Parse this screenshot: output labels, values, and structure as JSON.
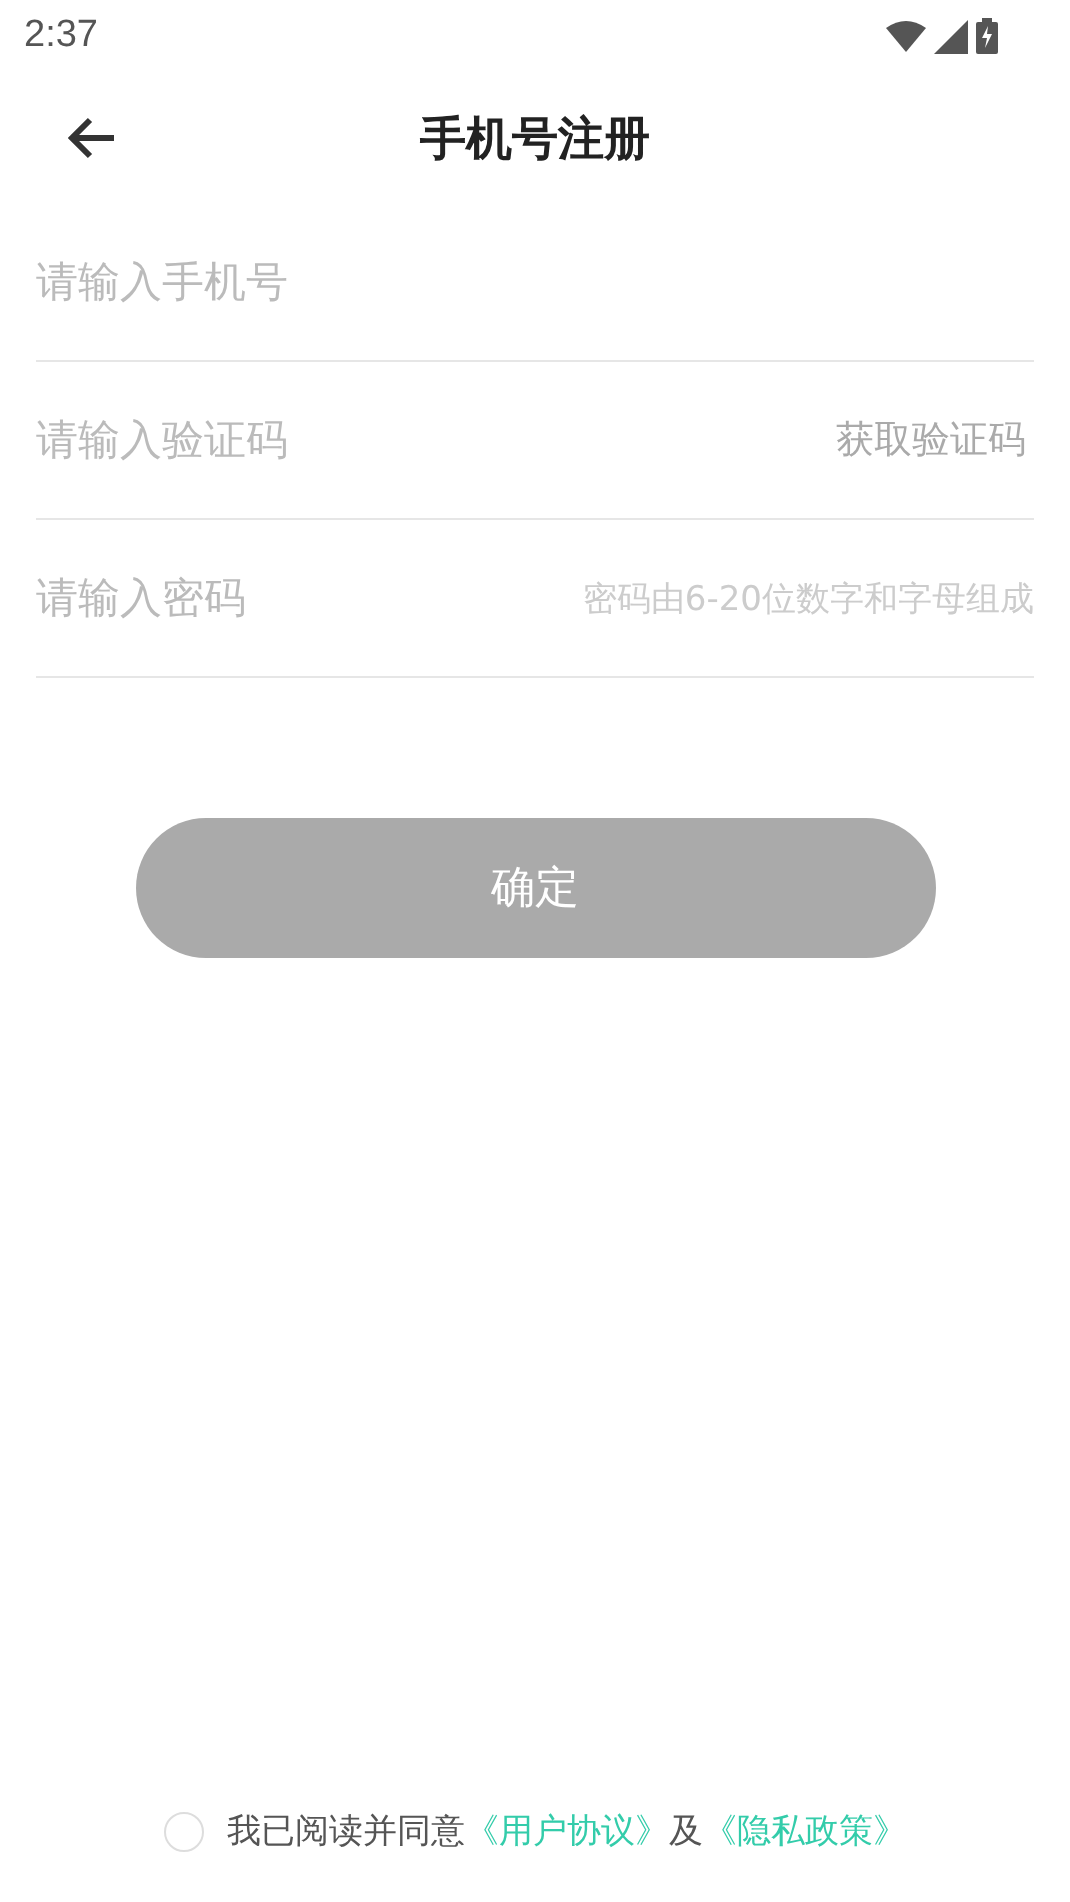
{
  "status_bar": {
    "time": "2:37"
  },
  "header": {
    "title": "手机号注册"
  },
  "fields": [
    {
      "kind": "plain",
      "placeholder": "请输入手机号"
    },
    {
      "kind": "code",
      "placeholder": "请输入验证码",
      "action": "获取验证码"
    },
    {
      "kind": "hint",
      "placeholder": "请输入密码",
      "hint": "密码由6-20位数字和字母组成"
    }
  ],
  "submit": {
    "label": "确定",
    "disabled": true
  },
  "agreement": {
    "checked": false,
    "text": "我已阅读并同意",
    "link_1": "《用户协议》",
    "joiner": "及",
    "link_2": "《隐私政策》"
  }
}
